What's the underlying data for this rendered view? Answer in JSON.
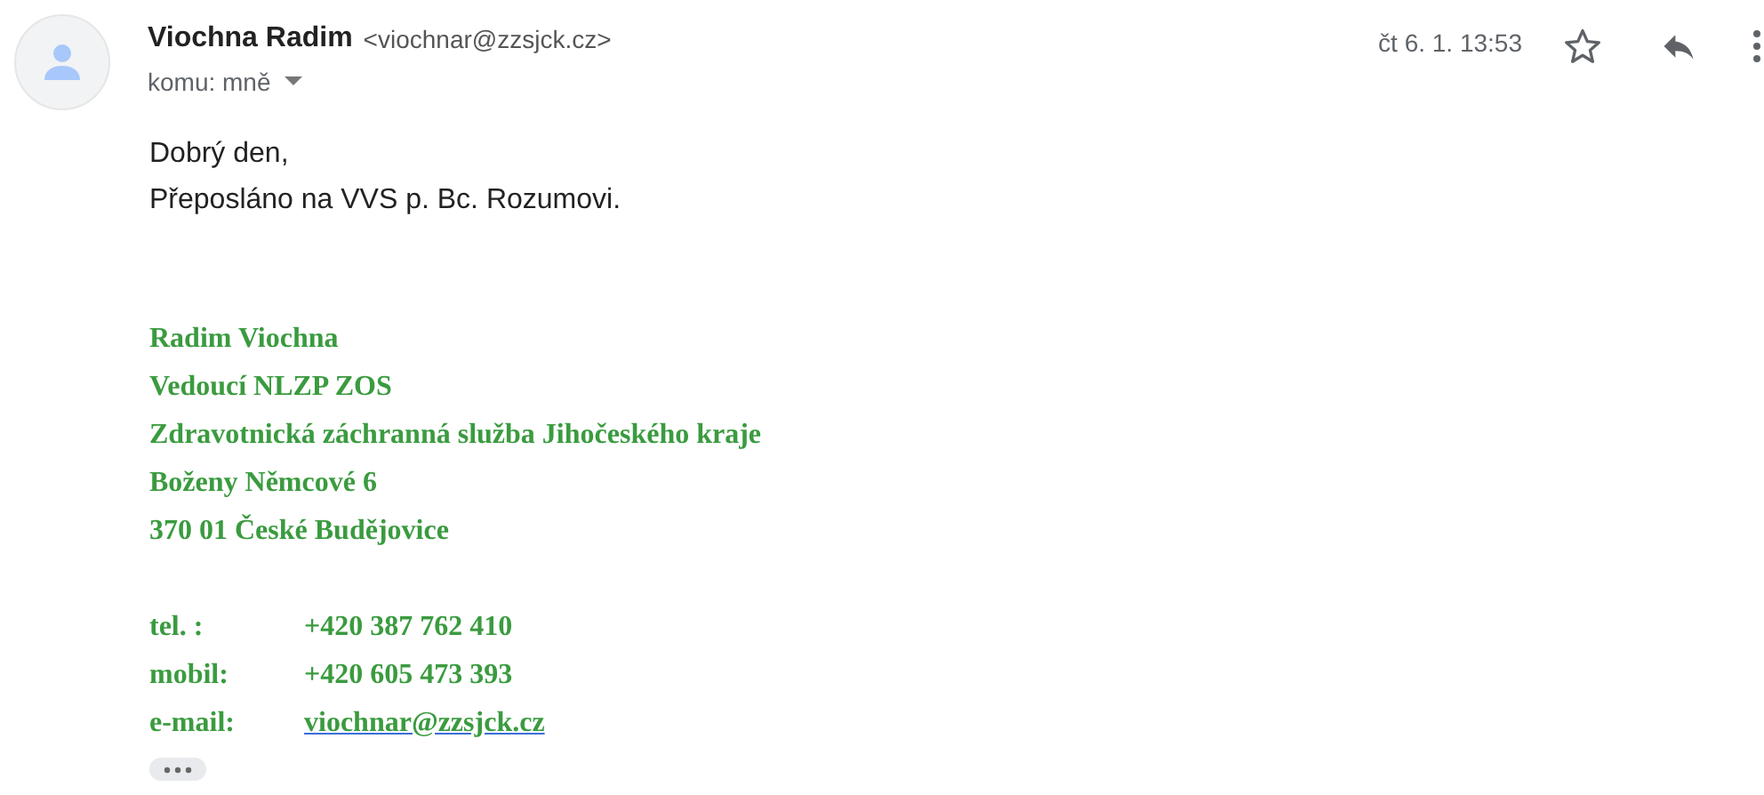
{
  "sender": {
    "name": "Viochna Radim",
    "address": "<viochnar@zzsjck.cz>"
  },
  "recipient": "komu: mně",
  "date": "čt 6. 1. 13:53",
  "starred": false,
  "body": [
    "Dobrý den,",
    "Přeposláno na VVS p. Bc. Rozumovi."
  ],
  "signature": {
    "lines": [
      "Radim Viochna",
      "Vedoucí NLZP ZOS",
      "Zdravotnická záchranná služba Jihočeského kraje",
      "Boženy Němcové 6",
      "370 01 České Budějovice"
    ],
    "contacts": [
      {
        "label": "tel. :",
        "value": "+420 387 762 410",
        "kind": "text"
      },
      {
        "label": "mobil:",
        "value": "+420 605 473 393",
        "kind": "text"
      },
      {
        "label": "e-mail:",
        "value": "viochnar@zzsjck.cz",
        "kind": "link"
      }
    ]
  }
}
